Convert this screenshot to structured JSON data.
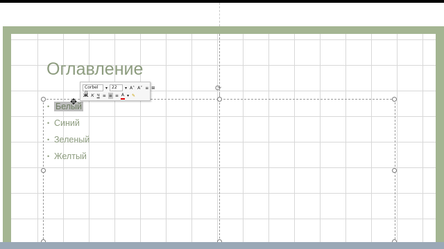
{
  "slide": {
    "title": "Оглавление",
    "bullets": [
      "Белый",
      "Синий",
      "Зеленый",
      "Желтый"
    ],
    "selected_index": 0
  },
  "mini_toolbar": {
    "font_name": "Corbel (I",
    "font_size": "22",
    "grow_font": "A",
    "shrink_font": "A",
    "bold": "Ж",
    "italic": "К",
    "underline": "Ч"
  },
  "colors": {
    "frame": "#a4b592",
    "title": "#8d9c7f",
    "selection": "#bdbdbd"
  },
  "icons": [
    "rotate-handle-icon",
    "move-cursor-icon",
    "font-color-icon",
    "format-painter-icon"
  ]
}
